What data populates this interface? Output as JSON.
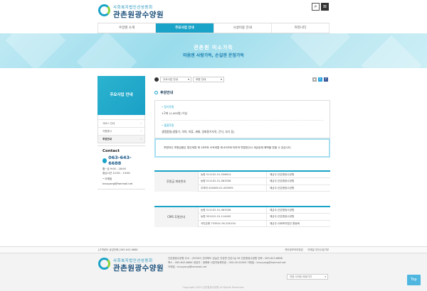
{
  "header": {
    "logo_sub": "사회복지법인선성동회",
    "logo_main": "관촌원광수양원",
    "search_icon": "search-icon",
    "menu_icon": "hamburger-menu-icon"
  },
  "gnb": {
    "items": [
      {
        "label": "수양원 소개"
      },
      {
        "label": "주요사업 안내"
      },
      {
        "label": "시설이용 안내"
      },
      {
        "label": "커뮤니티"
      }
    ]
  },
  "banner": {
    "title": "관촌원 미소가득",
    "subtitle": "마음엔 사랑가득, 손길엔 온정가득"
  },
  "sidebar": {
    "title": "주요사업 안내",
    "items": [
      {
        "label": "서비스 안내"
      },
      {
        "label": "자원봉사"
      },
      {
        "label": "후원안내"
      }
    ],
    "contact": {
      "title": "Contact",
      "phone": "063-643-6688",
      "hours_weekday": "월~금 9:00 - 18:00",
      "hours_lunch": "점심시간 12:00 - 13:00",
      "email_label": "• 이메일",
      "email": "kcsuyang@hanmail.net"
    }
  },
  "location": {
    "select1": "주요사업 안내",
    "select2": "후원 안내"
  },
  "content": {
    "section_title": "후원안내",
    "support_label": "• 정기후원",
    "support_value": "1구좌 (1,000원) 이상",
    "goods_label": "• 물품후원",
    "goods_value": "생필품들(생필기, 의약, 의류, 세제, 일회용기저귀, 간식, 부식 등)",
    "notice": "후원하신 후원금품은 법인세법 제 18조와 소득세법 제 65조에 의하여 연말정산시 세금공제 혜택을 받을 수 있습니다.",
    "table1": {
      "head": "후원금 계좌번호",
      "rows": [
        {
          "num": "농협 511102-51-036614",
          "holder": "예금주:관촌원광수양원"
        },
        {
          "num": "농협 511102-51-063336",
          "holder": "예금주:관촌원광수양원"
        },
        {
          "num": "우체국 400069-01-000995",
          "holder": "예금주:관촌원광수양원"
        }
      ]
    },
    "table2": {
      "head": "CMS 후원안내",
      "rows": [
        {
          "num": "농협 511102-51-063336",
          "holder": "예금주:관촌원광수양원"
        },
        {
          "num": "농협 551012-51-114400",
          "holder": "예금주:관촌원광수양원"
        },
        {
          "num": "국민은행 753501-95-200154",
          "holder": "예금주:사회복지법인 원동회"
        }
      ]
    }
  },
  "footer": {
    "top_left": "[고객센터 상담전화] 063-643-6688",
    "link1": "개인정보처리방침",
    "link2": "이메일 무단수집거부",
    "logo_sub": "사회복지법인선성동회",
    "logo_main": "관촌원광수양원",
    "line1": "관촌원광수양원    주소 : (55367) 전라북도 임실군 관촌면 관촌1길 36 관촌원광수양원    전화 : 063-643-6688",
    "line2": "팩스 : 063-643-6664    대표자 : 정해화    사업자등록번호 : 000-00-00000    이메일 : kcsuyang@hanmail.net",
    "line3": "이메일 : kcsuyang@hanmail.net",
    "family_site": "관련 사이트 바로가기",
    "copyright": "Copyright 2020 관촌원광수양원 All Rights Reserved.",
    "top_button": "Top"
  }
}
